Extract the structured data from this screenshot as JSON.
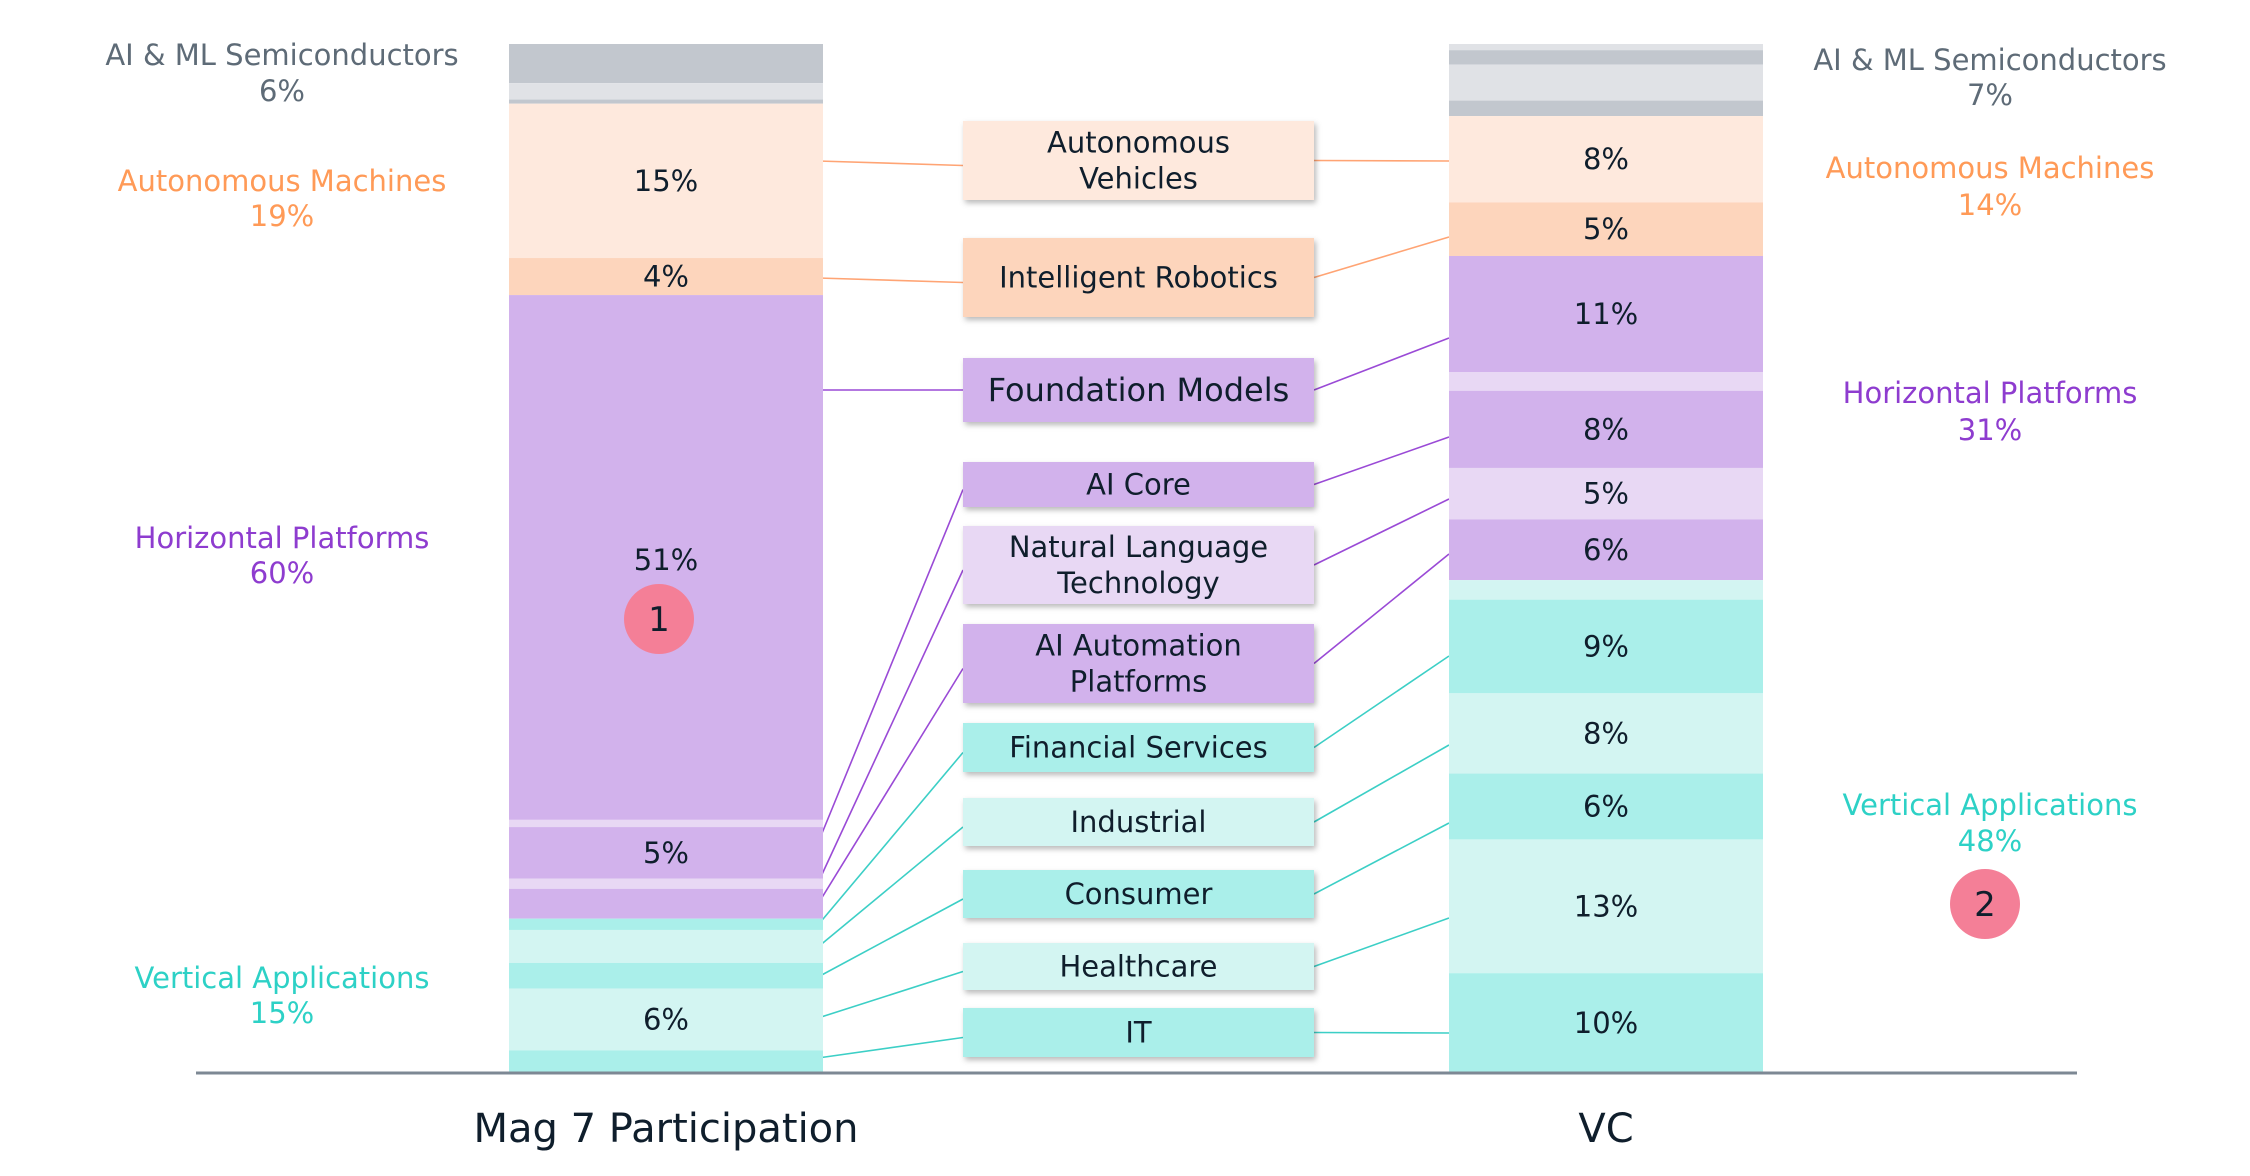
{
  "chart_data": {
    "type": "bar",
    "subtype": "stacked-100-percent-with-category-links",
    "title": "",
    "xlabel": "",
    "ylabel": "",
    "ylim": [
      0,
      100
    ],
    "categories": [
      "Mag 7 Participation",
      "VC"
    ],
    "colors": {
      "semis_dark": "#c2c7ce",
      "semis_light": "#e0e2e6",
      "am_light": "#fee9dd",
      "am_dark": "#fdd5bc",
      "hp_dark": "#d2b2ec",
      "hp_light": "#e8d8f4",
      "va_dark": "#aaefea",
      "va_light": "#d3f5f2",
      "link_orange": "#ffa474",
      "link_purple": "#9a4ad6",
      "link_teal": "#3ccfc6",
      "text_gray": "#5e6b77",
      "text_orange": "#ff9a57",
      "text_purple": "#8e3ccf",
      "text_teal": "#2dd1c6",
      "badge": "#f47f97",
      "axis": "#7d8894"
    },
    "groups": [
      {
        "name": "AI & ML Semiconductors",
        "color_key": "text_gray",
        "values": [
          "6%",
          "7%"
        ],
        "numeric": [
          6,
          7
        ]
      },
      {
        "name": "Autonomous Machines",
        "color_key": "text_orange",
        "values": [
          "19%",
          "14%"
        ],
        "numeric": [
          19,
          14
        ]
      },
      {
        "name": "Horizontal Platforms",
        "color_key": "text_purple",
        "values": [
          "60%",
          "31%"
        ],
        "numeric": [
          60,
          31
        ]
      },
      {
        "name": "Vertical Applications",
        "color_key": "text_teal",
        "values": [
          "15%",
          "48%"
        ],
        "numeric": [
          15,
          48
        ]
      }
    ],
    "subcategories": [
      {
        "name": "Autonomous Vehicles",
        "lines": [
          "Autonomous",
          "Vehicles"
        ],
        "group": "Autonomous Machines",
        "color_key": "am_light",
        "link": "link_orange"
      },
      {
        "name": "Intelligent Robotics",
        "lines": [
          "Intelligent Robotics"
        ],
        "group": "Autonomous Machines",
        "color_key": "am_dark",
        "link": "link_orange"
      },
      {
        "name": "Foundation Models",
        "lines": [
          "Foundation Models"
        ],
        "group": "Horizontal Platforms",
        "color_key": "hp_dark",
        "link": "link_purple",
        "emphasis": true
      },
      {
        "name": "AI Core",
        "lines": [
          "AI Core"
        ],
        "group": "Horizontal Platforms",
        "color_key": "hp_dark",
        "link": "link_purple"
      },
      {
        "name": "Natural Language Technology",
        "lines": [
          "Natural Language",
          "Technology"
        ],
        "group": "Horizontal Platforms",
        "color_key": "hp_light",
        "link": "link_purple"
      },
      {
        "name": "AI Automation Platforms",
        "lines": [
          "AI Automation",
          "Platforms"
        ],
        "group": "Horizontal Platforms",
        "color_key": "hp_dark",
        "link": "link_purple"
      },
      {
        "name": "Financial Services",
        "lines": [
          "Financial Services"
        ],
        "group": "Vertical Applications",
        "color_key": "va_dark",
        "link": "link_teal"
      },
      {
        "name": "Industrial",
        "lines": [
          "Industrial"
        ],
        "group": "Vertical Applications",
        "color_key": "va_light",
        "link": "link_teal"
      },
      {
        "name": "Consumer",
        "lines": [
          "Consumer"
        ],
        "group": "Vertical Applications",
        "color_key": "va_dark",
        "link": "link_teal"
      },
      {
        "name": "Healthcare",
        "lines": [
          "Healthcare"
        ],
        "group": "Vertical Applications",
        "color_key": "va_light",
        "link": "link_teal"
      },
      {
        "name": "IT",
        "lines": [
          "IT"
        ],
        "group": "Vertical Applications",
        "color_key": "va_dark",
        "link": "link_teal"
      }
    ],
    "series": [
      {
        "name": "Mag 7 Participation",
        "segments": [
          {
            "name": "AI & ML Semiconductors (a)",
            "value": 3.8,
            "label": "",
            "color_key": "semis_dark"
          },
          {
            "name": "AI & ML Semiconductors (b)",
            "value": 1.6,
            "label": "",
            "color_key": "semis_light"
          },
          {
            "name": "AI & ML Semiconductors (c)",
            "value": 0.4,
            "label": "",
            "color_key": "semis_dark"
          },
          {
            "name": "Autonomous Vehicles",
            "value": 15,
            "label": "15%",
            "color_key": "am_light"
          },
          {
            "name": "Intelligent Robotics",
            "value": 3.6,
            "label": "4%",
            "color_key": "am_dark"
          },
          {
            "name": "Foundation Models",
            "value": 51,
            "label": "51%",
            "color_key": "hp_dark"
          },
          {
            "name": "Other Horizontal",
            "value": 0.7,
            "label": "",
            "color_key": "hp_light"
          },
          {
            "name": "AI Core",
            "value": 5,
            "label": "5%",
            "color_key": "hp_dark"
          },
          {
            "name": "Natural Language Technology",
            "value": 1.0,
            "label": "",
            "color_key": "hp_light"
          },
          {
            "name": "AI Automation Platforms",
            "value": 2.9,
            "label": "",
            "color_key": "hp_dark"
          },
          {
            "name": "Financial Services",
            "value": 1.1,
            "label": "",
            "color_key": "va_dark"
          },
          {
            "name": "Industrial",
            "value": 3.2,
            "label": "",
            "color_key": "va_light"
          },
          {
            "name": "Consumer",
            "value": 2.5,
            "label": "",
            "color_key": "va_dark"
          },
          {
            "name": "Healthcare",
            "value": 6,
            "label": "6%",
            "color_key": "va_light"
          },
          {
            "name": "IT",
            "value": 2.2,
            "label": "",
            "color_key": "va_dark"
          }
        ]
      },
      {
        "name": "VC",
        "segments": [
          {
            "name": "AI & ML Semiconductors (a)",
            "value": 0.6,
            "label": "",
            "color_key": "semis_light"
          },
          {
            "name": "AI & ML Semiconductors (b)",
            "value": 1.4,
            "label": "",
            "color_key": "semis_dark"
          },
          {
            "name": "AI & ML Semiconductors (c)",
            "value": 3.5,
            "label": "",
            "color_key": "semis_light"
          },
          {
            "name": "AI & ML Semiconductors (d)",
            "value": 1.5,
            "label": "",
            "color_key": "semis_dark"
          },
          {
            "name": "Autonomous Vehicles",
            "value": 8.4,
            "label": "8%",
            "color_key": "am_light"
          },
          {
            "name": "Intelligent Robotics",
            "value": 5.2,
            "label": "5%",
            "color_key": "am_dark"
          },
          {
            "name": "Foundation Models",
            "value": 11.3,
            "label": "11%",
            "color_key": "hp_dark"
          },
          {
            "name": "Other Horizontal",
            "value": 1.8,
            "label": "",
            "color_key": "hp_light"
          },
          {
            "name": "AI Core",
            "value": 7.5,
            "label": "8%",
            "color_key": "hp_dark"
          },
          {
            "name": "Natural Language Technology",
            "value": 5,
            "label": "5%",
            "color_key": "hp_light"
          },
          {
            "name": "AI Automation Platforms",
            "value": 5.9,
            "label": "6%",
            "color_key": "hp_dark"
          },
          {
            "name": "Other Vertical",
            "value": 1.9,
            "label": "",
            "color_key": "va_light"
          },
          {
            "name": "Financial Services",
            "value": 9.1,
            "label": "9%",
            "color_key": "va_dark"
          },
          {
            "name": "Industrial",
            "value": 7.8,
            "label": "8%",
            "color_key": "va_light"
          },
          {
            "name": "Consumer",
            "value": 6.4,
            "label": "6%",
            "color_key": "va_dark"
          },
          {
            "name": "Healthcare",
            "value": 13,
            "label": "13%",
            "color_key": "va_light"
          },
          {
            "name": "IT",
            "value": 9.7,
            "label": "10%",
            "color_key": "va_dark"
          }
        ]
      }
    ],
    "badges": [
      {
        "label": "1",
        "placement": "Mag 7 Participation bar, below Foundation Models 51%"
      },
      {
        "label": "2",
        "placement": "right side, below Vertical Applications 48%"
      }
    ],
    "grid": false,
    "legend": "none"
  }
}
